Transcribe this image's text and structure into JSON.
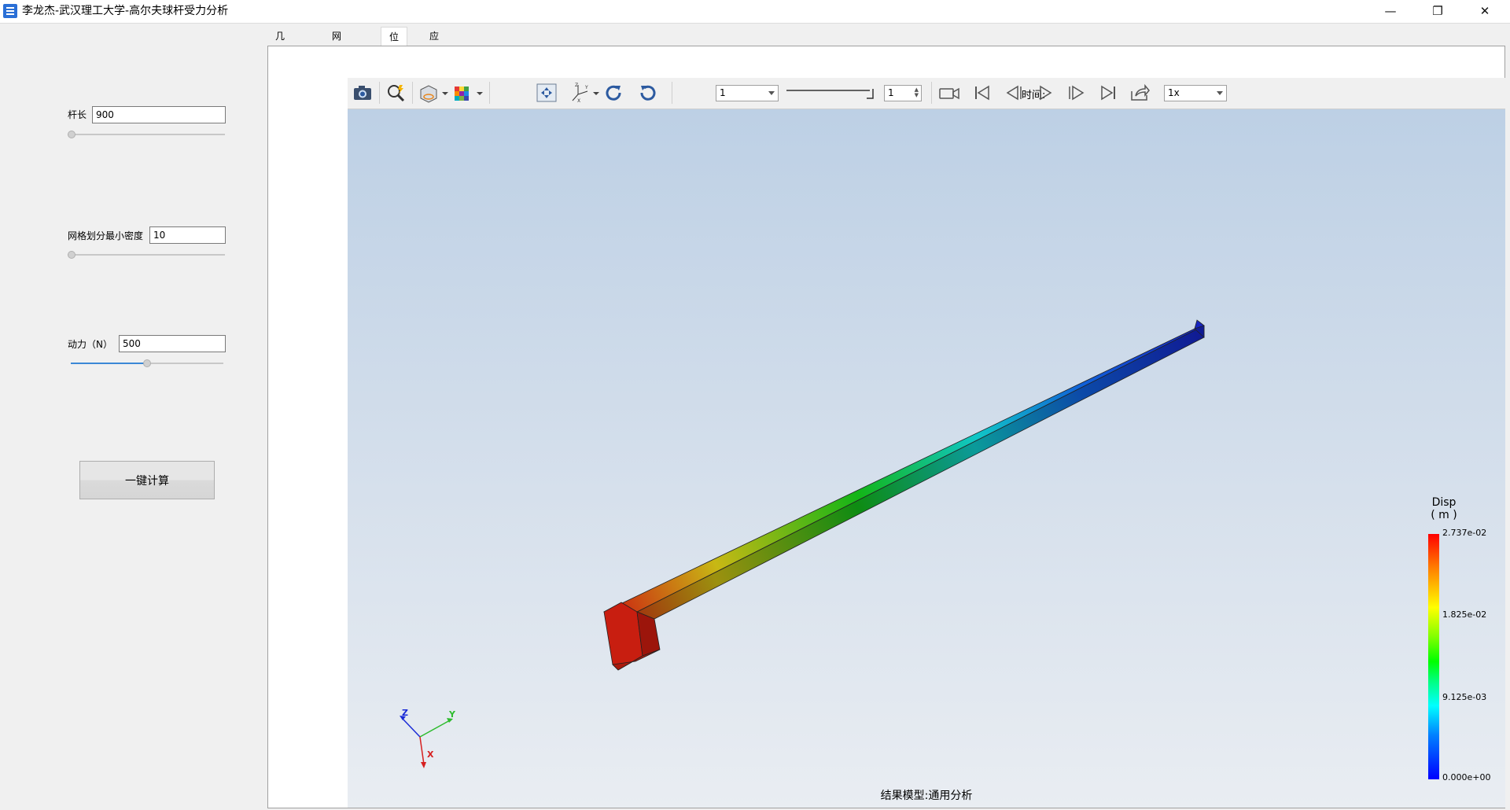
{
  "window": {
    "title": "李龙杰-武汉理工大学-高尔夫球杆受力分析",
    "min_glyph": "—",
    "max_glyph": "❐",
    "close_glyph": "✕"
  },
  "params": [
    {
      "label": "杆长",
      "value": "900",
      "slider_fraction": 0.0
    },
    {
      "label": "网格划分最小密度",
      "value": "10",
      "slider_fraction": 0.0
    },
    {
      "label": "动力（N）",
      "value": "500",
      "slider_fraction": 0.5
    }
  ],
  "calc_button": "一键计算",
  "tabs": [
    "几何结构",
    "网格划分",
    "位移",
    "应力"
  ],
  "active_tab": "位移",
  "toolbar": {
    "time_label": "时间:",
    "time_value": "1",
    "step_value": "1",
    "speed_value": "1x",
    "icons": [
      "camera-icon",
      "zoom-fit-icon",
      "view-cube-icon",
      "color-map-icon",
      "pan-icon",
      "axes-icon",
      "rotate-cw-icon",
      "rotate-ccw-icon",
      "record-icon",
      "first-frame-icon",
      "prev-frame-icon",
      "play-icon",
      "next-frame-icon",
      "last-frame-icon",
      "export-icon"
    ]
  },
  "viewport": {
    "caption": "结果模型:通用分析",
    "axis_labels": {
      "z": "Z",
      "y": "Y",
      "x": "X"
    }
  },
  "legend": {
    "title_line1": "Disp",
    "title_line2": "( m )",
    "ticks": [
      "2.737e-02",
      "1.825e-02",
      "9.125e-03",
      "0.000e+00"
    ],
    "max_color": "#ff0000",
    "min_color": "#0000ff"
  }
}
